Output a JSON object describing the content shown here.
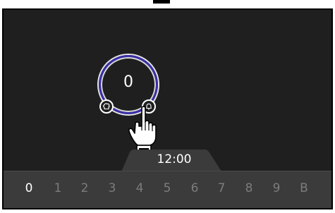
{
  "timer": {
    "value": "0"
  },
  "clock": {
    "time": "12:00"
  },
  "keypad": {
    "digits": [
      "0",
      "1",
      "2",
      "3",
      "4",
      "5",
      "6",
      "7",
      "8",
      "9",
      "B"
    ],
    "active_index": 0
  },
  "icons": {
    "left_ring_icon": "chef-hat-icon",
    "right_ring_icon": "bell-icon",
    "pointer": "hand-pointer-icon"
  },
  "colors": {
    "screen_background": "#1f1f1f",
    "ring_accent": "#3b2fa8",
    "bottom_bar": "#3b3b3b",
    "active_digit": "#ffffff",
    "inactive_digit": "#7c7c7c"
  }
}
